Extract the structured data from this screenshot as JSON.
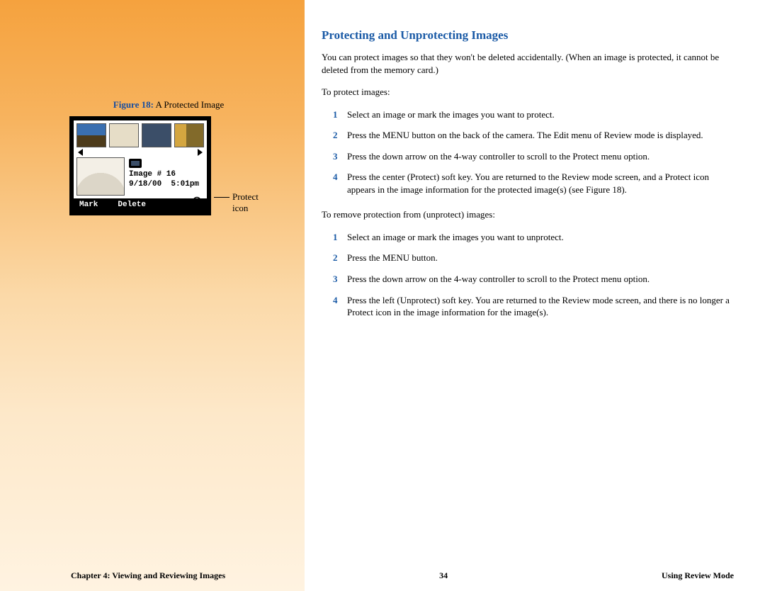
{
  "heading": "Protecting and Unprotecting Images",
  "intro": "You can protect images so that they won't be deleted accidentally. (When an image is protected, it cannot be deleted from the memory card.)",
  "sectionA_label": "To protect images:",
  "stepsA": [
    "Select an image or mark the images you want to protect.",
    "Press the MENU button on the back of the camera. The Edit menu of Review mode is displayed.",
    "Press the down arrow on the 4-way controller to scroll to the Protect menu option.",
    "Press the center (Protect) soft key. You are returned to the Review mode screen, and a Protect icon appears in the image information for the protected image(s) (see Figure 18)."
  ],
  "sectionB_label": "To remove protection from (unprotect) images:",
  "stepsB": [
    "Select an image or mark the images you want to unprotect.",
    "Press the MENU button.",
    "Press the down arrow on the 4-way controller to scroll to the Protect menu option.",
    "Press the left (Unprotect) soft key. You are returned to the Review mode screen, and there is no longer a Protect icon in the image information for the image(s)."
  ],
  "figure": {
    "label": "Figure 18:",
    "caption": "A Protected Image",
    "image_title": "Image # 16",
    "image_date": "9/18/00",
    "image_time": "5:01pm",
    "softkey_left": "Mark",
    "softkey_center": "Delete",
    "callout": "Protect icon"
  },
  "footer": {
    "left": "Chapter 4: Viewing and Reviewing Images",
    "center": "34",
    "right": "Using Review Mode"
  }
}
